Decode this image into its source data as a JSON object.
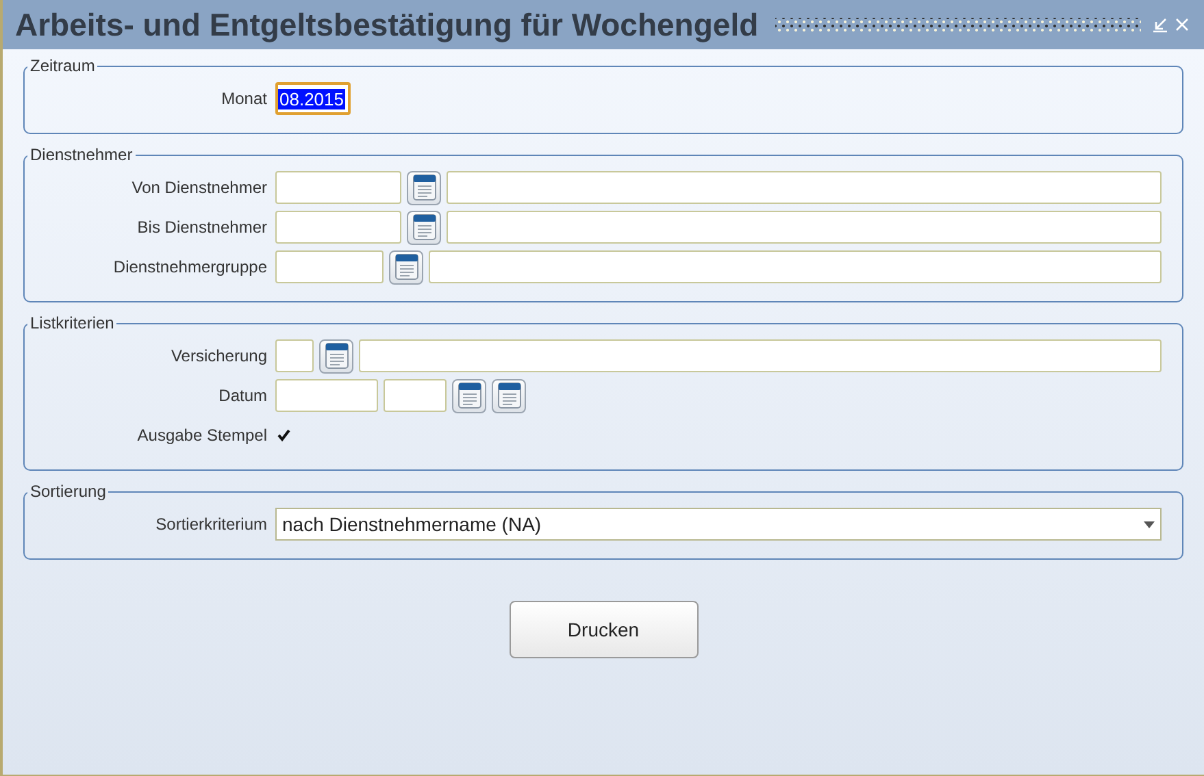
{
  "window": {
    "title": "Arbeits- und Entgeltsbestätigung für Wochengeld"
  },
  "sections": [
    {
      "legend": "Zeitraum",
      "rows": [
        {
          "label": "Monat",
          "fields": [
            {
              "kind": "month",
              "value": "08.2015",
              "selected": true
            }
          ]
        }
      ]
    },
    {
      "legend": "Dienstnehmer",
      "rows": [
        {
          "label": "Von Dienstnehmer",
          "fields": [
            {
              "kind": "code"
            },
            {
              "kind": "lookup"
            },
            {
              "kind": "name"
            }
          ]
        },
        {
          "label": "Bis Dienstnehmer",
          "fields": [
            {
              "kind": "code"
            },
            {
              "kind": "lookup"
            },
            {
              "kind": "name"
            }
          ]
        },
        {
          "label": "Dienstnehmergruppe",
          "fields": [
            {
              "kind": "group"
            },
            {
              "kind": "lookup"
            },
            {
              "kind": "name"
            }
          ]
        }
      ]
    },
    {
      "legend": "Listkriterien",
      "rows": [
        {
          "label": "Versicherung",
          "fields": [
            {
              "kind": "tiny"
            },
            {
              "kind": "lookup"
            },
            {
              "kind": "name"
            }
          ]
        },
        {
          "label": "Datum",
          "fields": [
            {
              "kind": "date"
            },
            {
              "kind": "time"
            },
            {
              "kind": "lookup"
            },
            {
              "kind": "lookup"
            }
          ]
        },
        {
          "label": "Ausgabe Stempel",
          "fields": [
            {
              "kind": "checkbox",
              "checked": true
            }
          ]
        }
      ]
    },
    {
      "legend": "Sortierung",
      "rows": [
        {
          "label": "Sortierkriterium",
          "fields": [
            {
              "kind": "select",
              "value": "nach Dienstnehmername (NA)"
            }
          ]
        }
      ]
    }
  ],
  "buttons": [
    "Drucken"
  ]
}
